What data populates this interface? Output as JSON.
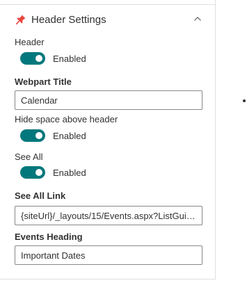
{
  "section": {
    "title": "Header Settings",
    "icons": {
      "pin": "pin-icon",
      "collapse": "chevron-up-icon"
    },
    "accent_color": "#03787c"
  },
  "fields": {
    "header": {
      "label": "Header",
      "toggle_state": "Enabled",
      "on": true
    },
    "webpart_title": {
      "label": "Webpart Title",
      "value": "Calendar"
    },
    "hide_space": {
      "label": "Hide space above header",
      "toggle_state": "Enabled",
      "on": true
    },
    "see_all": {
      "label": "See All",
      "toggle_state": "Enabled",
      "on": true
    },
    "see_all_link": {
      "label": "See All Link",
      "value": "{siteUrl}/_layouts/15/Events.aspx?ListGuid={..."
    },
    "events_heading": {
      "label": "Events Heading",
      "value": "Important Dates"
    }
  }
}
